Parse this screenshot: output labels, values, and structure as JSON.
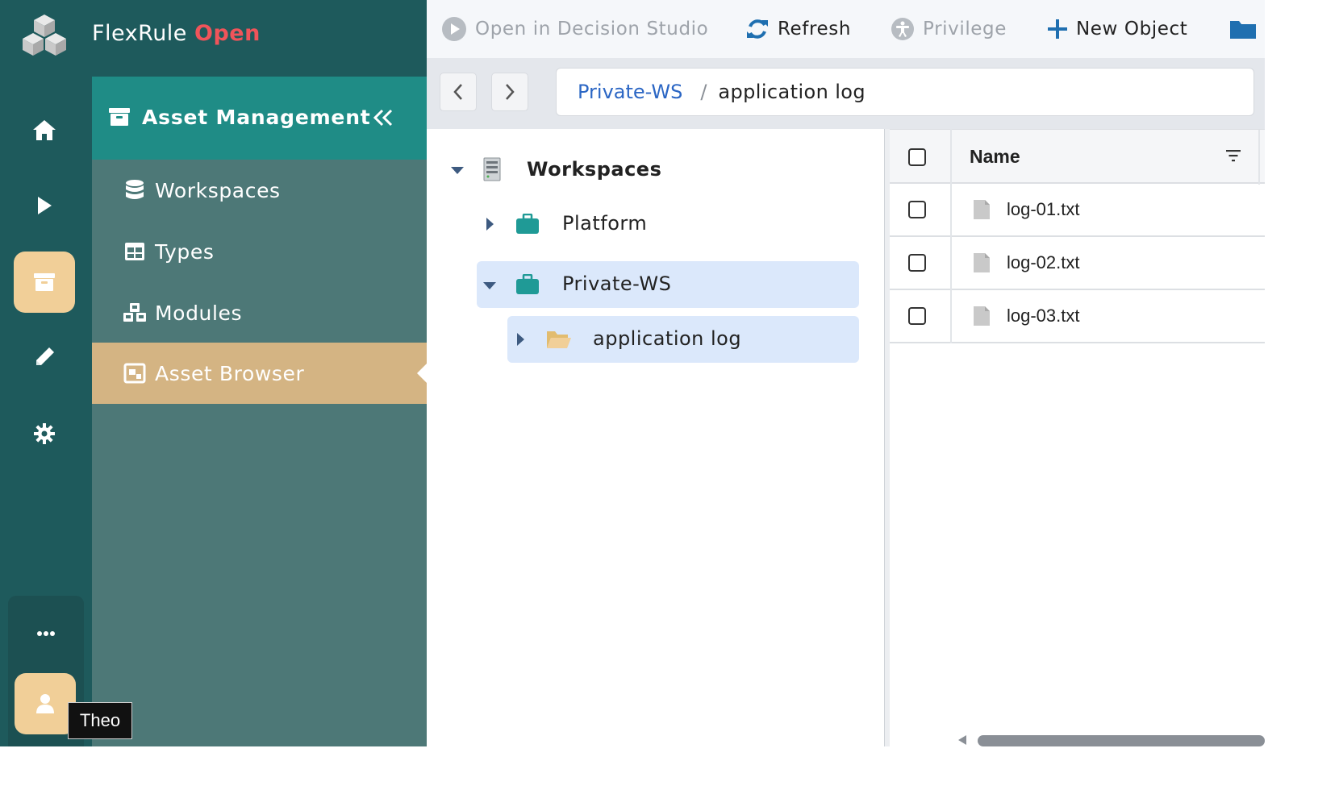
{
  "app": {
    "brand_name": "FlexRule",
    "brand_accent": "Open",
    "accent_color": "#f0545a",
    "rail_color": "#1e5a5c",
    "active_color": "#f1cf98"
  },
  "rail": {
    "items": [
      {
        "icon": "home-icon"
      },
      {
        "icon": "play-icon"
      },
      {
        "icon": "archive-icon",
        "active": true
      },
      {
        "icon": "pencil-icon"
      },
      {
        "icon": "gear-icon"
      }
    ],
    "more_icon": "ellipsis-icon",
    "user_name": "Theo"
  },
  "nav": {
    "title": "Asset Management",
    "items": [
      {
        "label": "Workspaces",
        "icon": "database-icon"
      },
      {
        "label": "Types",
        "icon": "table-icon"
      },
      {
        "label": "Modules",
        "icon": "cubes-icon"
      },
      {
        "label": "Asset Browser",
        "icon": "image-icon",
        "active": true
      }
    ]
  },
  "toolbar": {
    "open_studio": "Open in Decision Studio",
    "refresh": "Refresh",
    "privilege": "Privilege",
    "new_object": "New Object"
  },
  "breadcrumb": {
    "parent": "Private-WS",
    "separator": "/",
    "current": "application log"
  },
  "tree": {
    "root": "Workspaces",
    "nodes": [
      {
        "label": "Platform",
        "expanded": false
      },
      {
        "label": "Private-WS",
        "expanded": true
      },
      {
        "label": "application log",
        "expanded": false
      }
    ]
  },
  "grid": {
    "column_name": "Name",
    "rows": [
      {
        "name": "log-01.txt"
      },
      {
        "name": "log-02.txt"
      },
      {
        "name": "log-03.txt"
      }
    ]
  }
}
